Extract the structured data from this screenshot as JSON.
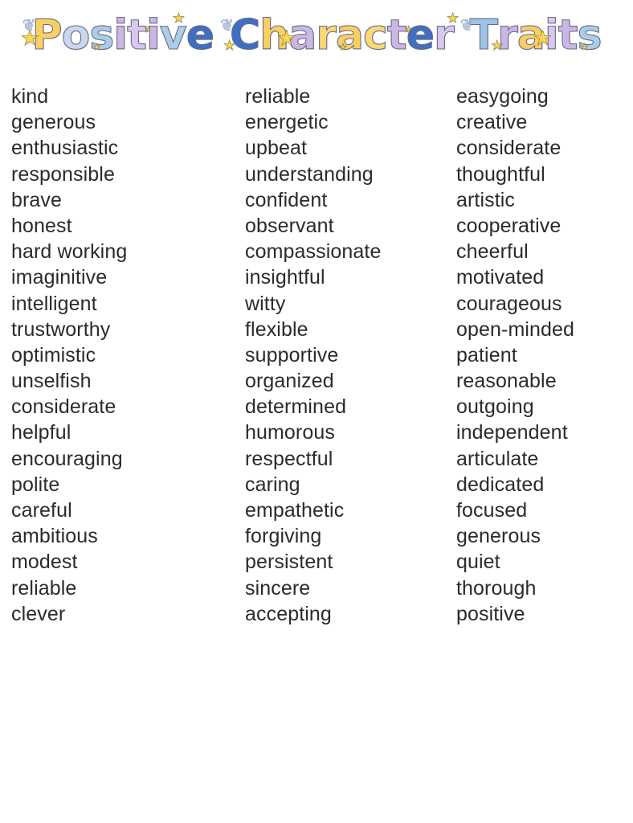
{
  "document": {
    "title": "Positive Character Traits",
    "title_words": [
      "Positive",
      "Character",
      "Traits"
    ],
    "background_color": "#ffffff",
    "text_color": "#2b2b2b",
    "title_colors": {
      "gold": "#f9cf62",
      "lavender": "#cbb6e4",
      "light_blue": "#aacdea",
      "dark_blue": "#3f6fc4",
      "star_yellow": "#fbd64f",
      "outline": "#6a6a86"
    },
    "title_letters": [
      {
        "char": "P",
        "color_class": "c-gold"
      },
      {
        "char": "o",
        "color_class": "c-check"
      },
      {
        "char": "s",
        "color_class": "c-blue"
      },
      {
        "char": "i",
        "color_class": "c-lav"
      },
      {
        "char": "t",
        "color_class": "c-lav2"
      },
      {
        "char": "i",
        "color_class": "c-lav"
      },
      {
        "char": "v",
        "color_class": "c-blue"
      },
      {
        "char": "e",
        "color_class": "c-dblue"
      },
      {
        "char": "C",
        "color_class": "c-dblue"
      },
      {
        "char": "h",
        "color_class": "c-gold"
      },
      {
        "char": "a",
        "color_class": "c-lav"
      },
      {
        "char": "r",
        "color_class": "c-gold2"
      },
      {
        "char": "a",
        "color_class": "c-gold"
      },
      {
        "char": "c",
        "color_class": "c-gold2"
      },
      {
        "char": "t",
        "color_class": "c-lav"
      },
      {
        "char": "e",
        "color_class": "c-dblue"
      },
      {
        "char": "r",
        "color_class": "c-lav2"
      },
      {
        "char": "T",
        "color_class": "c-blue2"
      },
      {
        "char": "r",
        "color_class": "c-lav"
      },
      {
        "char": "a",
        "color_class": "c-gold"
      },
      {
        "char": "i",
        "color_class": "c-lav2"
      },
      {
        "char": "t",
        "color_class": "c-lav"
      },
      {
        "char": "s",
        "color_class": "c-blue"
      }
    ]
  },
  "columns": [
    {
      "name": "column-1",
      "traits": [
        "kind",
        "generous",
        "enthusiastic",
        "responsible",
        "brave",
        "honest",
        "hard working",
        "imaginitive",
        "intelligent",
        "trustworthy",
        "optimistic",
        "unselfish",
        "considerate",
        "helpful",
        "encouraging",
        "polite",
        "careful",
        "ambitious",
        "modest",
        "reliable",
        "clever"
      ]
    },
    {
      "name": "column-2",
      "traits": [
        "reliable",
        "energetic",
        "upbeat",
        "understanding",
        "confident",
        "observant",
        "compassionate",
        "insightful",
        "witty",
        "flexible",
        "supportive",
        "organized",
        "determined",
        "humorous",
        "respectful",
        "caring",
        "empathetic",
        "forgiving",
        "persistent",
        "sincere",
        "accepting"
      ]
    },
    {
      "name": "column-3",
      "traits": [
        "easygoing",
        "creative",
        "considerate",
        "thoughtful",
        "artistic",
        "cooperative",
        "cheerful",
        "motivated",
        "courageous",
        "open-minded",
        "patient",
        "reasonable",
        "outgoing",
        "independent",
        "articulate",
        "dedicated",
        "focused",
        "generous",
        "quiet",
        "thorough",
        "positive"
      ]
    }
  ]
}
